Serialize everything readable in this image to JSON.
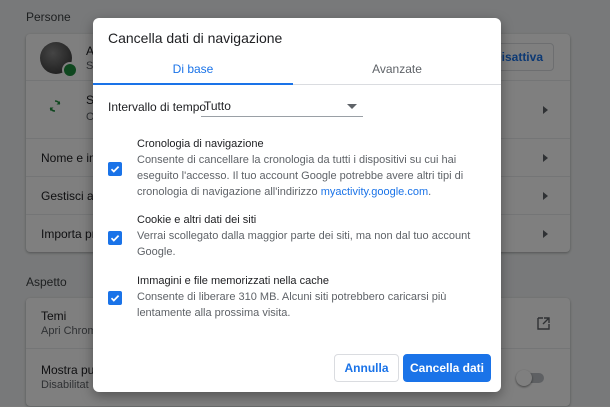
{
  "background": {
    "people_section": {
      "title": "Persone",
      "account_name": "A",
      "account_sub": "S",
      "disable_button": "Disattiva",
      "sync_label": "S",
      "sync_sub": "O",
      "name_row": "Nome e im",
      "manage_row": "Gestisci alt",
      "import_row": "Importa pre"
    },
    "appearance_section": {
      "title": "Aspetto",
      "themes_label": "Temi",
      "themes_sub": "Apri Chrom",
      "show_label": "Mostra puls",
      "show_sub": "Disabilitat"
    }
  },
  "dialog": {
    "title": "Cancella dati di navigazione",
    "tabs": [
      {
        "label": "Di base",
        "active": true
      },
      {
        "label": "Avanzate",
        "active": false
      }
    ],
    "time_range": {
      "label": "Intervallo di tempo",
      "value": "Tutto"
    },
    "options": [
      {
        "title": "Cronologia di navigazione",
        "desc_pre": "Consente di cancellare la cronologia da tutti i dispositivi su cui hai eseguito l'accesso. Il tuo account Google potrebbe avere altri tipi di cronologia di navigazione all'indirizzo ",
        "desc_link": "myactivity.google.com",
        "desc_post": ".",
        "checked": true
      },
      {
        "title": "Cookie e altri dati dei siti",
        "desc": "Verrai scollegato dalla maggior parte dei siti, ma non dal tuo account Google.",
        "checked": true
      },
      {
        "title": "Immagini e file memorizzati nella cache",
        "desc": "Consente di liberare 310 MB. Alcuni siti potrebbero caricarsi più lentamente alla prossima visita.",
        "checked": true
      }
    ],
    "buttons": {
      "cancel": "Annulla",
      "confirm": "Cancella dati"
    }
  },
  "colors": {
    "accent": "#1a73e8",
    "overlay": "rgba(0,0,0,0.5)"
  }
}
